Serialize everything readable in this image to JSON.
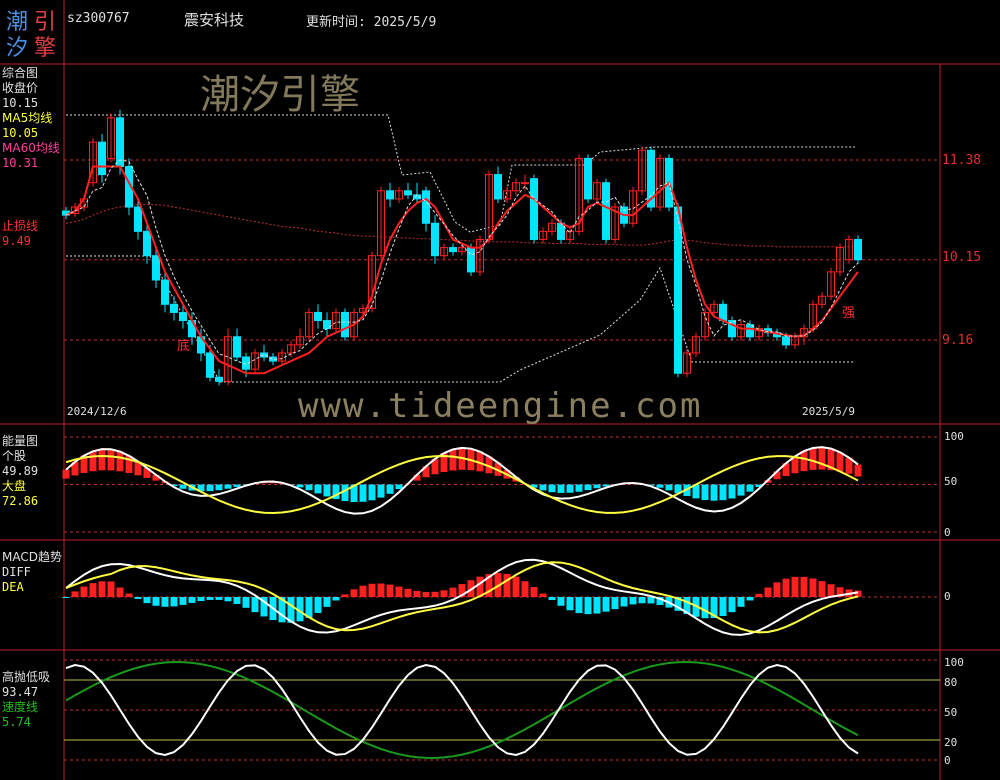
{
  "header": {
    "logo_chars": [
      "潮",
      "引",
      "汐",
      "擎"
    ],
    "code": "sz300767",
    "name": "震安科技",
    "update_label": "更新时间: 2025/5/9"
  },
  "colors": {
    "up": "#ff2020",
    "down": "#00e5ff",
    "ma5": "#ffffff",
    "ma60": "#ff2020",
    "guide": "#c03030",
    "yellow": "#ffff40",
    "green": "#1a9a1a",
    "frame": "#c02020"
  },
  "watermark": {
    "title": "潮汐引擎",
    "url": "www.tideengine.com"
  },
  "main_panel": {
    "title": "综合图",
    "close_label": "收盘价",
    "close_value": "10.15",
    "ma5_label": "MA5均线",
    "ma5_value": "10.05",
    "ma60_label": "MA60均线",
    "ma60_value": "10.31",
    "stop_label": "止损线",
    "stop_value": "9.49",
    "bottom_mark": "底",
    "strong_mark": "强",
    "start_date": "2024/12/6",
    "end_date": "2025/5/9",
    "right_ticks": [
      "11.38",
      "10.15",
      "9.16"
    ]
  },
  "energy_panel": {
    "title": "能量图",
    "stock_label": "个股",
    "stock_value": "49.89",
    "market_label": "大盘",
    "market_value": "72.86",
    "right_ticks": [
      "100",
      "50",
      "0"
    ]
  },
  "macd_panel": {
    "title": "MACD趋势",
    "diff_label": "DIFF",
    "dea_label": "DEA",
    "right_ticks": [
      "0"
    ]
  },
  "kdj_panel": {
    "title": "高抛低吸",
    "value": "93.47",
    "speed_label": "速度线",
    "speed_value": "5.74",
    "right_ticks": [
      "100",
      "80",
      "50",
      "20",
      "0"
    ]
  },
  "chart_data": {
    "type": "candlestick",
    "candles": [
      [
        10.75,
        10.7,
        10.8,
        10.65
      ],
      [
        10.72,
        10.8,
        10.85,
        10.68
      ],
      [
        10.8,
        10.9,
        10.95,
        10.75
      ],
      [
        11.1,
        11.6,
        11.65,
        11.05
      ],
      [
        11.6,
        11.2,
        11.7,
        11.1
      ],
      [
        11.4,
        11.9,
        11.95,
        11.35
      ],
      [
        11.9,
        11.3,
        12.0,
        11.2
      ],
      [
        11.3,
        10.8,
        11.4,
        10.7
      ],
      [
        10.8,
        10.5,
        10.9,
        10.4
      ],
      [
        10.5,
        10.2,
        10.6,
        10.1
      ],
      [
        10.2,
        9.9,
        10.3,
        9.8
      ],
      [
        9.9,
        9.6,
        10.0,
        9.5
      ],
      [
        9.6,
        9.5,
        9.7,
        9.4
      ],
      [
        9.5,
        9.4,
        9.6,
        9.3
      ],
      [
        9.4,
        9.2,
        9.5,
        9.1
      ],
      [
        9.2,
        9.0,
        9.3,
        8.9
      ],
      [
        9.0,
        8.7,
        9.1,
        8.65
      ],
      [
        8.7,
        8.65,
        8.8,
        8.6
      ],
      [
        8.65,
        9.2,
        9.3,
        8.6
      ],
      [
        9.2,
        8.95,
        9.3,
        8.9
      ],
      [
        8.95,
        8.8,
        9.0,
        8.7
      ],
      [
        8.8,
        9.0,
        9.05,
        8.75
      ],
      [
        9.0,
        8.95,
        9.1,
        8.9
      ],
      [
        8.95,
        8.9,
        9.0,
        8.85
      ],
      [
        8.9,
        9.0,
        9.05,
        8.85
      ],
      [
        9.0,
        9.1,
        9.15,
        8.95
      ],
      [
        9.1,
        9.2,
        9.3,
        9.05
      ],
      [
        9.2,
        9.5,
        9.55,
        9.15
      ],
      [
        9.5,
        9.4,
        9.6,
        9.3
      ],
      [
        9.4,
        9.3,
        9.5,
        9.2
      ],
      [
        9.3,
        9.5,
        9.55,
        9.25
      ],
      [
        9.5,
        9.2,
        9.55,
        9.15
      ],
      [
        9.2,
        9.5,
        9.55,
        9.15
      ],
      [
        9.5,
        9.55,
        9.6,
        9.45
      ],
      [
        9.55,
        10.2,
        10.25,
        9.5
      ],
      [
        10.2,
        11.0,
        11.05,
        10.15
      ],
      [
        11.0,
        10.9,
        11.1,
        10.8
      ],
      [
        10.9,
        11.0,
        11.05,
        10.85
      ],
      [
        11.0,
        10.95,
        11.1,
        10.9
      ],
      [
        10.95,
        10.9,
        11.1,
        10.85
      ],
      [
        11.0,
        10.6,
        11.05,
        10.5
      ],
      [
        10.6,
        10.2,
        10.7,
        10.1
      ],
      [
        10.2,
        10.3,
        10.35,
        10.15
      ],
      [
        10.3,
        10.25,
        10.35,
        10.2
      ],
      [
        10.25,
        10.3,
        10.35,
        10.2
      ],
      [
        10.3,
        10.0,
        10.35,
        9.95
      ],
      [
        10.0,
        10.4,
        10.45,
        9.95
      ],
      [
        10.4,
        11.2,
        11.25,
        10.35
      ],
      [
        11.2,
        10.9,
        11.3,
        10.85
      ],
      [
        10.9,
        11.0,
        11.05,
        10.85
      ],
      [
        11.0,
        11.1,
        11.15,
        10.95
      ],
      [
        11.1,
        11.1,
        11.2,
        11.0
      ],
      [
        11.15,
        10.4,
        11.2,
        10.35
      ],
      [
        10.4,
        10.5,
        10.55,
        10.35
      ],
      [
        10.5,
        10.6,
        10.65,
        10.45
      ],
      [
        10.6,
        10.4,
        10.65,
        10.35
      ],
      [
        10.4,
        10.5,
        10.55,
        10.35
      ],
      [
        10.5,
        11.4,
        11.45,
        10.45
      ],
      [
        11.4,
        10.9,
        11.45,
        10.85
      ],
      [
        10.9,
        11.1,
        11.15,
        10.85
      ],
      [
        11.1,
        10.4,
        11.15,
        10.35
      ],
      [
        10.4,
        10.8,
        10.85,
        10.35
      ],
      [
        10.8,
        10.6,
        10.85,
        10.55
      ],
      [
        10.6,
        11.0,
        11.05,
        10.55
      ],
      [
        11.0,
        11.5,
        11.55,
        10.95
      ],
      [
        11.5,
        10.8,
        11.55,
        10.75
      ],
      [
        10.8,
        11.4,
        11.45,
        10.75
      ],
      [
        11.4,
        10.8,
        11.45,
        10.75
      ],
      [
        10.8,
        8.75,
        10.85,
        8.7
      ],
      [
        8.75,
        9.0,
        9.05,
        8.7
      ],
      [
        9.0,
        9.2,
        9.25,
        8.95
      ],
      [
        9.2,
        9.5,
        9.55,
        9.15
      ],
      [
        9.5,
        9.6,
        9.65,
        9.45
      ],
      [
        9.6,
        9.4,
        9.65,
        9.35
      ],
      [
        9.4,
        9.2,
        9.45,
        9.15
      ],
      [
        9.2,
        9.35,
        9.4,
        9.15
      ],
      [
        9.35,
        9.2,
        9.4,
        9.15
      ],
      [
        9.2,
        9.3,
        9.35,
        9.15
      ],
      [
        9.3,
        9.25,
        9.35,
        9.2
      ],
      [
        9.25,
        9.2,
        9.3,
        9.15
      ],
      [
        9.2,
        9.1,
        9.25,
        9.05
      ],
      [
        9.1,
        9.2,
        9.25,
        9.05
      ],
      [
        9.2,
        9.3,
        9.35,
        9.1
      ],
      [
        9.3,
        9.6,
        9.65,
        9.25
      ],
      [
        9.6,
        9.7,
        9.75,
        9.55
      ],
      [
        9.7,
        10.0,
        10.05,
        9.65
      ],
      [
        10.0,
        10.3,
        10.35,
        9.95
      ],
      [
        10.15,
        10.4,
        10.45,
        10.1
      ],
      [
        10.4,
        10.15,
        10.45,
        10.1
      ]
    ],
    "ma60": [
      10.6,
      10.62,
      10.65,
      10.7,
      10.74,
      10.78,
      10.8,
      10.82,
      10.83,
      10.83,
      10.83,
      10.82,
      10.8,
      10.78,
      10.76,
      10.74,
      10.72,
      10.7,
      10.68,
      10.66,
      10.64,
      10.62,
      10.6,
      10.58,
      10.56,
      10.55,
      10.54,
      10.52,
      10.5,
      10.49,
      10.48,
      10.46,
      10.45,
      10.44,
      10.44,
      10.43,
      10.43,
      10.42,
      10.42,
      10.41,
      10.41,
      10.4,
      10.4,
      10.39,
      10.39,
      10.38,
      10.38,
      10.38,
      10.37,
      10.37,
      10.37,
      10.36,
      10.36,
      10.36,
      10.35,
      10.35,
      10.35,
      10.35,
      10.34,
      10.34,
      10.34,
      10.34,
      10.33,
      10.33,
      10.33,
      10.34,
      10.36,
      10.38,
      10.4,
      10.39,
      10.38,
      10.36,
      10.35,
      10.34,
      10.33,
      10.33,
      10.32,
      10.32,
      10.32,
      10.31,
      10.31,
      10.31,
      10.31,
      10.31,
      10.31,
      10.31,
      10.31,
      10.31,
      10.31
    ],
    "stop_line": [
      10.7,
      10.75,
      10.9,
      11.3,
      11.3,
      11.3,
      11.3,
      11.1,
      10.9,
      10.6,
      10.3,
      10.0,
      9.8,
      9.6,
      9.4,
      9.2,
      9.05,
      8.9,
      8.85,
      8.8,
      8.75,
      8.75,
      8.75,
      8.8,
      8.85,
      8.9,
      8.95,
      9.0,
      9.1,
      9.2,
      9.25,
      9.3,
      9.35,
      9.45,
      9.7,
      10.1,
      10.4,
      10.6,
      10.75,
      10.85,
      10.9,
      10.8,
      10.6,
      10.4,
      10.35,
      10.3,
      10.3,
      10.4,
      10.6,
      10.75,
      10.85,
      10.95,
      10.9,
      10.8,
      10.7,
      10.6,
      10.55,
      10.6,
      10.8,
      10.85,
      10.8,
      10.75,
      10.7,
      10.7,
      10.8,
      10.9,
      11.0,
      11.1,
      10.8,
      10.3,
      9.9,
      9.6,
      9.45,
      9.4,
      9.35,
      9.3,
      9.3,
      9.28,
      9.26,
      9.24,
      9.22,
      9.2,
      9.22,
      9.3,
      9.4,
      9.55,
      9.7,
      9.85,
      10.0
    ],
    "right_ticks": [
      "11.38",
      "10.15",
      "9.16"
    ],
    "energy": {
      "right_ticks": [
        "100",
        "50",
        "0"
      ]
    },
    "kdj": {
      "right_ticks": [
        "100",
        "80",
        "50",
        "20",
        "0"
      ]
    }
  }
}
